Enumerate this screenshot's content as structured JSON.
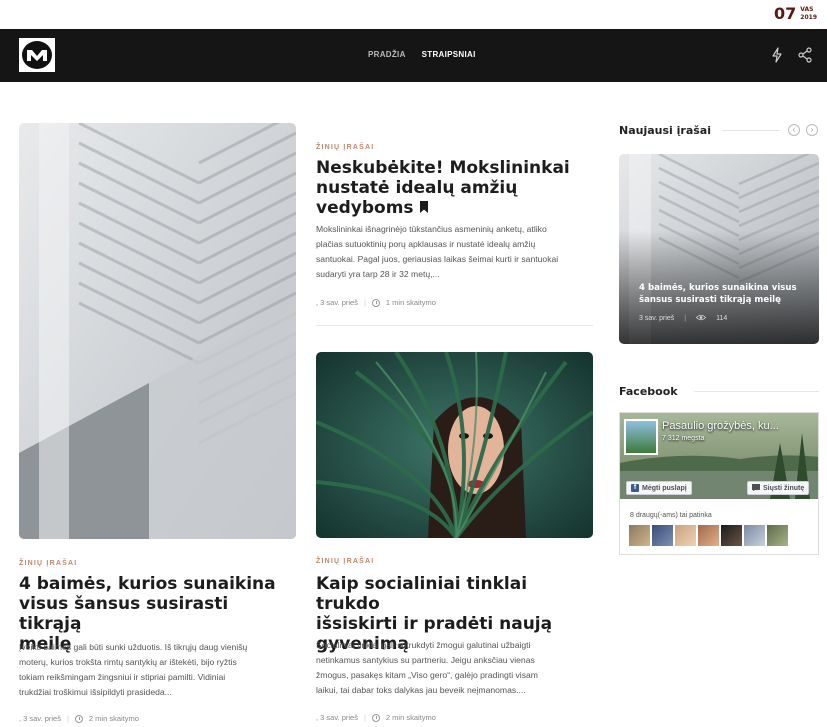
{
  "date": {
    "day": "07",
    "month": "VAS",
    "year": "2019"
  },
  "nav": {
    "links": [
      {
        "label": "PRADŽIA"
      },
      {
        "label": "STRAIPSNIAI"
      }
    ]
  },
  "posts": {
    "featured": {
      "category": "ŽINIŲ ĮRAŠAI",
      "title_lines": [
        "4 baimės, kurios sunaikina",
        "visus šansus susirasti tikrąją",
        "meilę"
      ],
      "excerpt_lines": [
        "Įveikti baimes gali būti sunki užduotis. Iš tikrųjų daug vienišų",
        "moterų, kurios trokšta rimtų santykių ar ištekėti, bijo ryžtis",
        "tokiam reikšmingam žingsniui ir stipriai pamilti. Vidiniai",
        "trukdžiai troškimui išsipildyti prasideda..."
      ],
      "meta": {
        "time": ", 3 sav. prieš",
        "read": "2 min skaitymo"
      }
    },
    "top_right": {
      "category": "ŽINIŲ ĮRAŠAI",
      "title_lines": [
        "Neskubėkite! Mokslininkai",
        "nustatė idealų amžių",
        "vedyboms"
      ],
      "excerpt_lines": [
        "Mokslininkai išnagrinėjo tūkstančius asmeninių anketų, atliko",
        "plačias sutuoktinių porų apklausas ir nustatė idealų amžių",
        "santuokai. Pagal juos, geriausias laikas šeimai kurti ir santuokai",
        "sudaryti yra tarp 28 ir 32 metų,..."
      ],
      "meta": {
        "time": ", 3 sav. prieš",
        "read": "1 min skaitymo"
      }
    },
    "bottom_right": {
      "category": "ŽINIŲ ĮRAŠAI",
      "title_lines": [
        "Kaip socialiniai tinklai trukdo",
        "išsiskirti ir pradėti naują",
        "gyvenimą"
      ],
      "excerpt_lines": [
        "Socialiniai tinklai gali sutrukdyti žmogui galutinai užbaigti",
        "netinkamus santykius su partneriu. Jeigu anksčiau vienas",
        "žmogus, pasakęs kitam „Viso gero“, galėjo pradingti visam",
        "laikui, tai dabar toks dalykas jau beveik neįmanomas...."
      ],
      "meta": {
        "time": ", 3 sav. prieš",
        "read": "2 min skaitymo"
      }
    }
  },
  "sidebar": {
    "latest_heading": "Naujausi įrašai",
    "latest_post": {
      "title_lines": [
        "4 baimės, kurios sunaikina visus",
        "šansus susirasti tikrąją meilę"
      ],
      "time": "3 sav. prieš",
      "views": "114"
    },
    "facebook_heading": "Facebook",
    "facebook": {
      "page_name": "Pasaulio grožybės, ku...",
      "followers": "7 312 mėgsta",
      "like_label": "Mėgti puslapį",
      "message_label": "Siųsti žinutę",
      "friends_text": "8 draugų(-ams) tai patinka"
    }
  },
  "colors": {
    "accent": "#c5866a",
    "nav_bg": "#151515",
    "date": "#5a1a12",
    "facebook": "#3b5998"
  }
}
